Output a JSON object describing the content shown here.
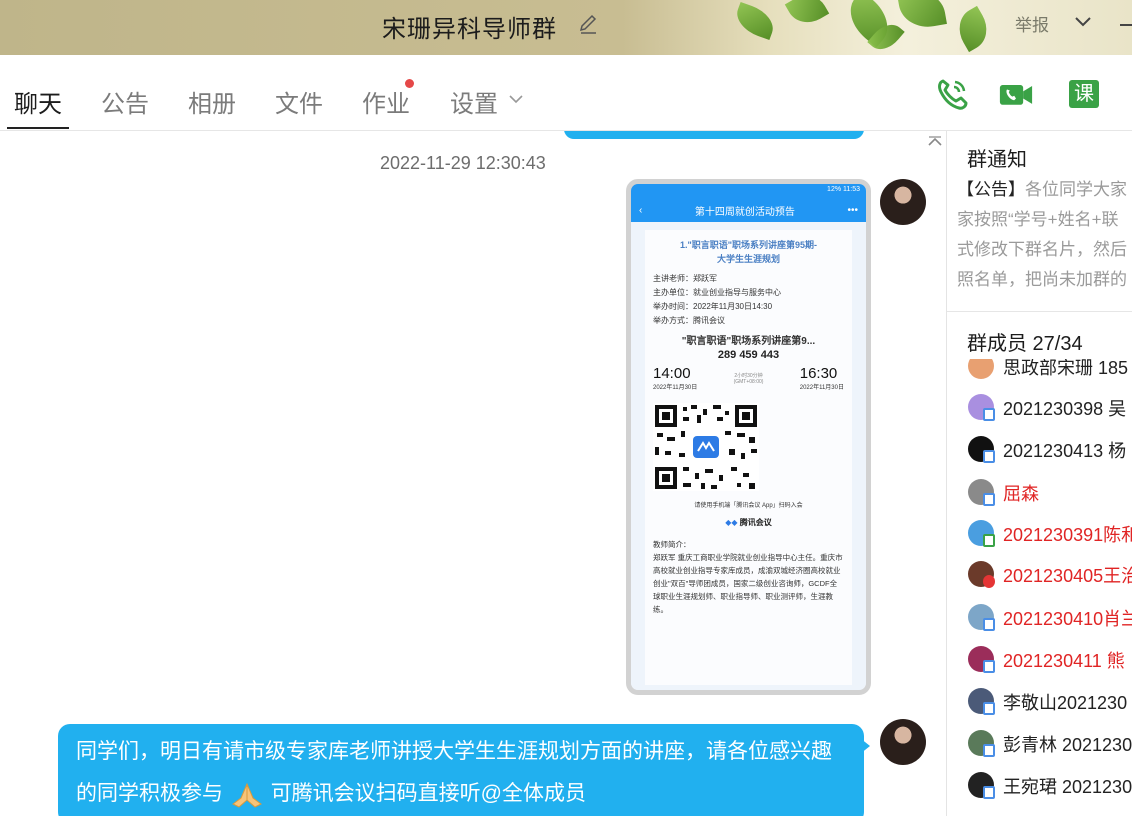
{
  "window": {
    "title": "宋珊异科导师群",
    "report_label": "举报"
  },
  "tabs": [
    {
      "label": "聊天",
      "active": true
    },
    {
      "label": "公告"
    },
    {
      "label": "相册"
    },
    {
      "label": "文件"
    },
    {
      "label": "作业",
      "has_dot": true
    },
    {
      "label": "设置"
    }
  ],
  "toolbar": {
    "voice_call_icon": "phone-icon",
    "video_call_icon": "video-icon",
    "course_label": "课"
  },
  "chat": {
    "timestamp": "2022-11-29 12:30:43",
    "image_message": {
      "nav_title": "第十四周就创活动预告",
      "status_left": "",
      "status_right": "12%  11:53",
      "poster_title_line1": "1.\"职言职语\"职场系列讲座第95期-",
      "poster_title_line2": "大学生生涯规划",
      "lines": [
        "主讲老师：郑跃军",
        "主办单位：就业创业指导与服务中心",
        "举办时间：2022年11月30日14:30",
        "举办方式：腾讯会议"
      ],
      "meeting_title": "\"职言职语\"职场系列讲座第9...",
      "meeting_id": "289 459 443",
      "start_time": "14:00",
      "end_time": "16:30",
      "start_date": "2022年11月30日",
      "end_date": "2022年11月30日",
      "duration": "2小时30分钟",
      "timezone": "(GMT+08:00)",
      "qr_caption": "请使用手机端「腾讯会议 App」扫码入会",
      "brand": "腾讯会议",
      "teacher_label": "教师简介：",
      "teacher_bio": "郑跃军 重庆工商职业学院就业创业指导中心主任。重庆市高校就业创业指导专家库成员，成渝双城经济圈高校就业创业\"双百\"导师团成员，国家二级创业咨询师，GCDF全球职业生涯规划师、职业指导师、职业测评师，生涯教练。"
    },
    "text_message": {
      "part1": "同学们，明日有请市级专家库老师讲授大学生生涯规划方面的讲座，请各位感兴趣的同学积极参与",
      "part2": " 可腾讯会议扫码直接听@全体成员"
    }
  },
  "sidebar": {
    "notice_title": "群通知",
    "notice_tag": "【公告】",
    "notice_lines": [
      "各位同学大家",
      "家按照“学号+姓名+联",
      "式修改下群名片，然后",
      "照名单，把尚未加群的"
    ],
    "members_title": "群成员 27/34",
    "members": [
      {
        "name": "思政部宋珊  185",
        "red": false
      },
      {
        "name": "2021230398 吴",
        "red": false
      },
      {
        "name": "2021230413 杨",
        "red": false
      },
      {
        "name": "屈森",
        "red": true
      },
      {
        "name": "2021230391陈和",
        "red": true
      },
      {
        "name": "2021230405王治",
        "red": true
      },
      {
        "name": "2021230410肖兰",
        "red": true
      },
      {
        "name": "2021230411 熊",
        "red": true
      },
      {
        "name": "李敬山2021230",
        "red": false
      },
      {
        "name": "彭青林 2021230",
        "red": false
      },
      {
        "name": "王宛珺 2021230",
        "red": false
      }
    ]
  }
}
